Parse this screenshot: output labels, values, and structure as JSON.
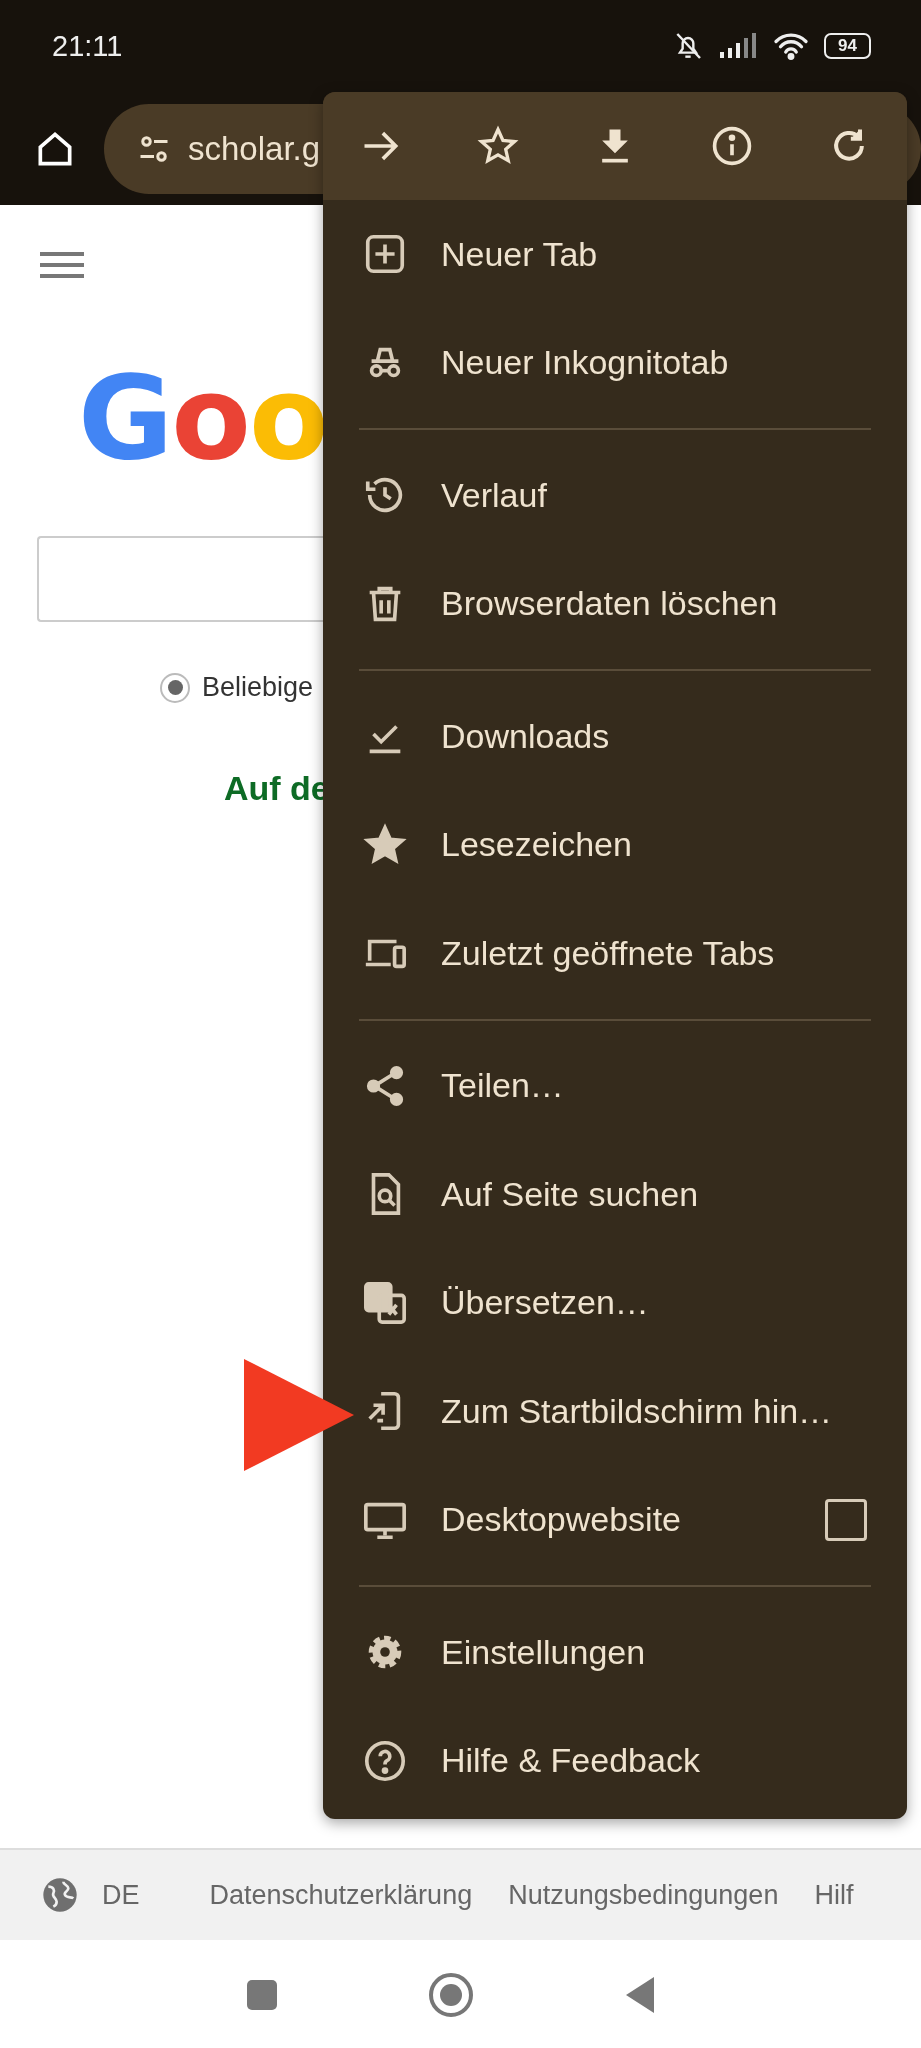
{
  "status_bar": {
    "time": "21:11",
    "battery": "94"
  },
  "toolbar": {
    "url": "scholar.g"
  },
  "page": {
    "logo": [
      {
        "text": "G",
        "color": "#4285f4"
      },
      {
        "text": "o",
        "color": "#ea4335"
      },
      {
        "text": "o",
        "color": "#fbbc05"
      }
    ],
    "radio": {
      "label": "Beliebige",
      "selected": true
    },
    "link": "Auf de"
  },
  "menu": {
    "sections": [
      [
        {
          "kind": "plain",
          "label": "Neuer Tab"
        },
        {
          "kind": "plain",
          "label": "Neuer Inkognitotab"
        }
      ],
      [
        {
          "kind": "plain",
          "label": "Verlauf"
        },
        {
          "kind": "plain",
          "label": "Browserdaten löschen"
        }
      ],
      [
        {
          "kind": "plain",
          "label": "Downloads"
        },
        {
          "kind": "plain",
          "label": "Lesezeichen"
        },
        {
          "kind": "plain",
          "label": "Zuletzt geöffnete Tabs"
        }
      ],
      [
        {
          "kind": "plain",
          "label": "Teilen…"
        },
        {
          "kind": "plain",
          "label": "Auf Seite suchen"
        },
        {
          "kind": "plain",
          "label": "Übersetzen…"
        },
        {
          "kind": "plain",
          "label": "Zum Startbildschirm hin…"
        },
        {
          "kind": "checkbox",
          "label": "Desktopwebsite",
          "checked": false
        }
      ],
      [
        {
          "kind": "plain",
          "label": "Einstellungen"
        },
        {
          "kind": "plain",
          "label": "Hilfe & Feedback"
        }
      ]
    ]
  },
  "footer": {
    "language": "DE",
    "links": [
      "Datenschutzerklärung",
      "Nutzungsbedingungen",
      "Hilf"
    ]
  }
}
